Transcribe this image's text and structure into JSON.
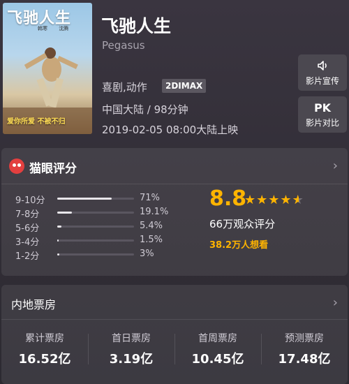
{
  "movie": {
    "title_cn": "飞驰人生",
    "title_en": "Pegasus",
    "genre": "喜剧,动作",
    "format_badge": "2DIMAX",
    "region_duration": "中国大陆 / 98分钟",
    "release": "2019-02-05 08:00大陆上映"
  },
  "poster": {
    "title": "飞驰人生",
    "credit_a": "韩寒",
    "credit_b": "沈腾",
    "slogan": "爱你所爱 不被不归"
  },
  "side_buttons": {
    "promo_label": "影片宣传",
    "pk_icon_text": "PK",
    "pk_label": "影片对比"
  },
  "rating": {
    "section_title": "猫眼评分",
    "distribution": [
      {
        "label": "9-10分",
        "pct": "71%",
        "fraction": 0.71
      },
      {
        "label": "7-8分",
        "pct": "19.1%",
        "fraction": 0.191
      },
      {
        "label": "5-6分",
        "pct": "5.4%",
        "fraction": 0.054
      },
      {
        "label": "3-4分",
        "pct": "1.5%",
        "fraction": 0.015
      },
      {
        "label": "1-2分",
        "pct": "3%",
        "fraction": 0.03
      }
    ],
    "score": "8.8",
    "stars_out_of_5": 4.4,
    "viewers": "66万观众评分",
    "wants": "38.2万人想看"
  },
  "box_office": {
    "section_title": "内地票房",
    "items": [
      {
        "label": "累计票房",
        "value": "16.52亿"
      },
      {
        "label": "首日票房",
        "value": "3.19亿"
      },
      {
        "label": "首周票房",
        "value": "10.45亿"
      },
      {
        "label": "预测票房",
        "value": "17.48亿"
      }
    ]
  },
  "colors": {
    "accent_score": "#ffb400",
    "logo_red": "#e33f3f"
  }
}
